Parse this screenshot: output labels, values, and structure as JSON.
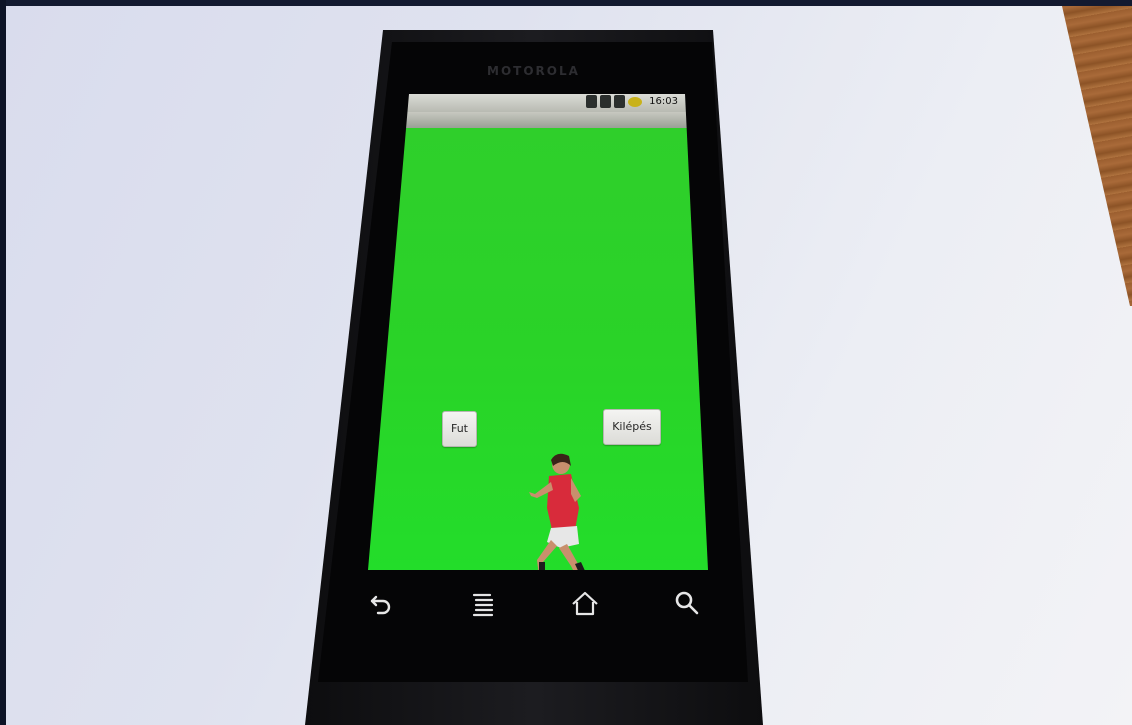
{
  "device": {
    "brand": "MOTOROLA"
  },
  "status_bar": {
    "time": "16:03",
    "icons": [
      "usb-icon",
      "sd-card-icon",
      "signal-icon",
      "battery-icon"
    ]
  },
  "app": {
    "background_color": "#2ad328",
    "buttons": {
      "fut_label": "Fut",
      "kilepes_label": "Kilépés"
    },
    "sprite": "runner-figure"
  },
  "nav_bar": {
    "icons": [
      "back-icon",
      "menu-icon",
      "home-icon",
      "search-icon"
    ]
  }
}
